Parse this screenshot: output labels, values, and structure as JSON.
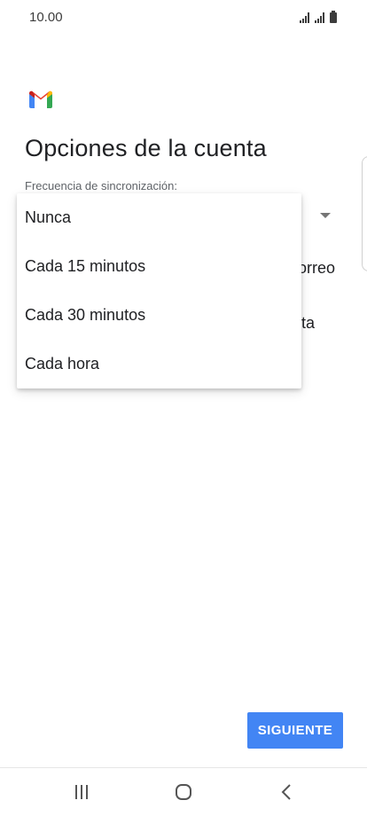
{
  "status_bar": {
    "time": "10.00",
    "icons": [
      "signal-icon",
      "signal-icon",
      "battery-icon"
    ]
  },
  "app": {
    "logo": "gmail-logo",
    "title": "Opciones de la cuenta"
  },
  "sync": {
    "label": "Frecuencia de sincronización:"
  },
  "dropdown": {
    "options": [
      "Nunca",
      "Cada 15 minutos",
      "Cada 30 minutos",
      "Cada hora"
    ]
  },
  "background_text": {
    "line1": "orreo",
    "line2": "ita"
  },
  "actions": {
    "next_label": "SIGUIENTE"
  },
  "nav": {
    "recent": "recent-apps-icon",
    "home": "home-icon",
    "back": "back-icon"
  },
  "colors": {
    "accent": "#4285f4",
    "gmail_red": "#ea4335",
    "gmail_blue": "#4285f4",
    "gmail_green": "#34a853",
    "gmail_yellow": "#fbbc04"
  }
}
